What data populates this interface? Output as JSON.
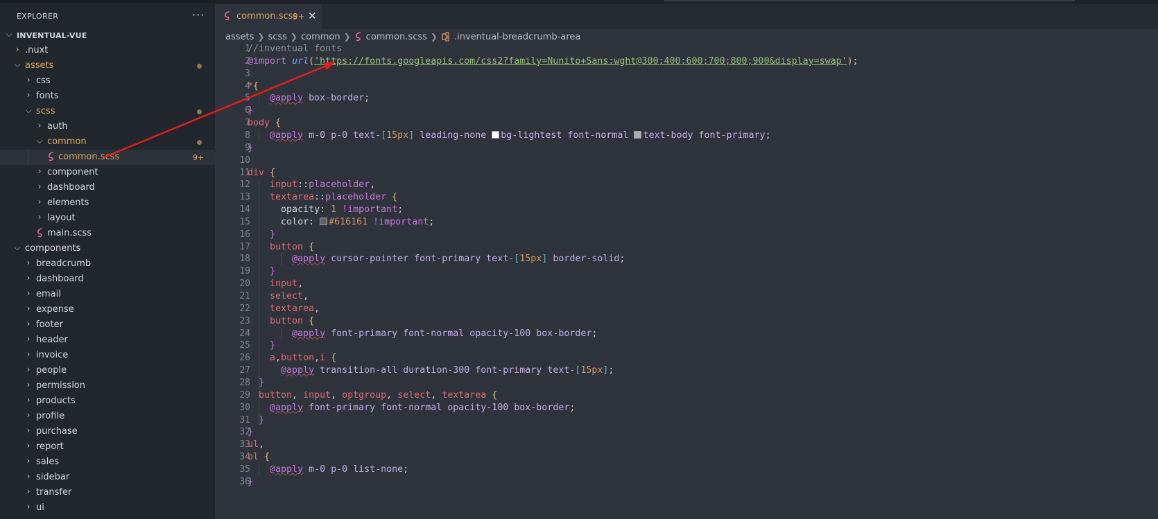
{
  "sidebar": {
    "title": "EXPLORER",
    "more_label": "···",
    "root": "INVENTUAL-VUE",
    "items": [
      {
        "label": ".nuxt",
        "name": "tree-folder-nuxt",
        "open": false
      },
      {
        "label": "assets",
        "name": "tree-folder-assets",
        "open": true,
        "modified": true
      },
      {
        "label": "css",
        "name": "tree-folder-css",
        "open": false
      },
      {
        "label": "fonts",
        "name": "tree-folder-fonts",
        "open": false
      },
      {
        "label": "scss",
        "name": "tree-folder-scss",
        "open": true,
        "modified": true
      },
      {
        "label": "auth",
        "name": "tree-folder-auth",
        "open": false
      },
      {
        "label": "common",
        "name": "tree-folder-common",
        "open": true,
        "modified": true
      },
      {
        "label": "common.scss",
        "name": "tree-file-common-scss",
        "badge": "9+",
        "selected": true
      },
      {
        "label": "component",
        "name": "tree-folder-component",
        "open": false
      },
      {
        "label": "dashboard",
        "name": "tree-folder-dashboard",
        "open": false
      },
      {
        "label": "elements",
        "name": "tree-folder-elements",
        "open": false
      },
      {
        "label": "layout",
        "name": "tree-folder-layout",
        "open": false
      },
      {
        "label": "main.scss",
        "name": "tree-file-main-scss"
      },
      {
        "label": "components",
        "name": "tree-folder-components",
        "open": true
      },
      {
        "label": "breadcrumb",
        "name": "tree-folder-breadcrumb",
        "open": false
      },
      {
        "label": "dashboard",
        "name": "tree-folder-components-dashboard",
        "open": false
      },
      {
        "label": "email",
        "name": "tree-folder-email",
        "open": false
      },
      {
        "label": "expense",
        "name": "tree-folder-expense",
        "open": false
      },
      {
        "label": "footer",
        "name": "tree-folder-footer",
        "open": false
      },
      {
        "label": "header",
        "name": "tree-folder-header",
        "open": false
      },
      {
        "label": "invoice",
        "name": "tree-folder-invoice",
        "open": false
      },
      {
        "label": "people",
        "name": "tree-folder-people",
        "open": false
      },
      {
        "label": "permission",
        "name": "tree-folder-permission",
        "open": false
      },
      {
        "label": "products",
        "name": "tree-folder-products",
        "open": false
      },
      {
        "label": "profile",
        "name": "tree-folder-profile",
        "open": false
      },
      {
        "label": "purchase",
        "name": "tree-folder-purchase",
        "open": false
      },
      {
        "label": "report",
        "name": "tree-folder-report",
        "open": false
      },
      {
        "label": "sales",
        "name": "tree-folder-sales",
        "open": false
      },
      {
        "label": "sidebar",
        "name": "tree-folder-sidebar",
        "open": false
      },
      {
        "label": "transfer",
        "name": "tree-folder-transfer",
        "open": false
      },
      {
        "label": "ui",
        "name": "tree-folder-ui",
        "open": false
      }
    ]
  },
  "tab": {
    "label": "common.scss",
    "badge": "9+",
    "close": "✕"
  },
  "breadcrumb": [
    "assets",
    "scss",
    "common",
    "common.scss",
    ".inventual-breadcrumb-area"
  ],
  "editor": {
    "line_numbers": [
      "1",
      "2",
      "3",
      "4",
      "5",
      "6",
      "7",
      "8",
      "9",
      "10",
      "11",
      "12",
      "13",
      "14",
      "15",
      "16",
      "17",
      "18",
      "19",
      "20",
      "21",
      "22",
      "23",
      "24",
      "25",
      "26",
      "27",
      "28",
      "29",
      "30",
      "31",
      "32",
      "33",
      "34",
      "35",
      "36"
    ],
    "lines": [
      "//inventual fonts",
      "@import url('https://fonts.googleapis.com/css2?family=Nunito+Sans:wght@300;400;600;700;800;900&display=swap');",
      "",
      "*{",
      "    @apply box-border;",
      "}",
      "body {",
      "    @apply m-0 p-0 text-[15px] leading-none bg-lightest font-normal text-body font-primary;",
      "}",
      "",
      "div {",
      "    input::placeholder,",
      "    textarea::placeholder {",
      "      opacity: 1 !important;",
      "      color: #616161 !important;",
      "    }",
      "    button {",
      "        @apply cursor-pointer font-primary text-[15px] border-solid;",
      "    }",
      "    input,",
      "    select,",
      "    textarea,",
      "    button {",
      "        @apply font-primary font-normal opacity-100 box-border;",
      "    }",
      "    a,button,i {",
      "      @apply transition-all duration-300 font-primary text-[15px];",
      "  }",
      "  button, input, optgroup, select, textarea {",
      "    @apply font-primary font-normal opacity-100 box-border;",
      "  }",
      "}",
      "ul,",
      "ol {",
      "    @apply m-0 p-0 list-none;",
      "}"
    ]
  },
  "colors": {
    "sidebar_bg": "#22262d",
    "editor_bg": "#2e333c",
    "modified": "#d9a862",
    "keyword": "#c679dd",
    "string": "#98c379",
    "selector": "#e06c75",
    "brace": "#e5c07b",
    "arrow": "#e0201c"
  }
}
